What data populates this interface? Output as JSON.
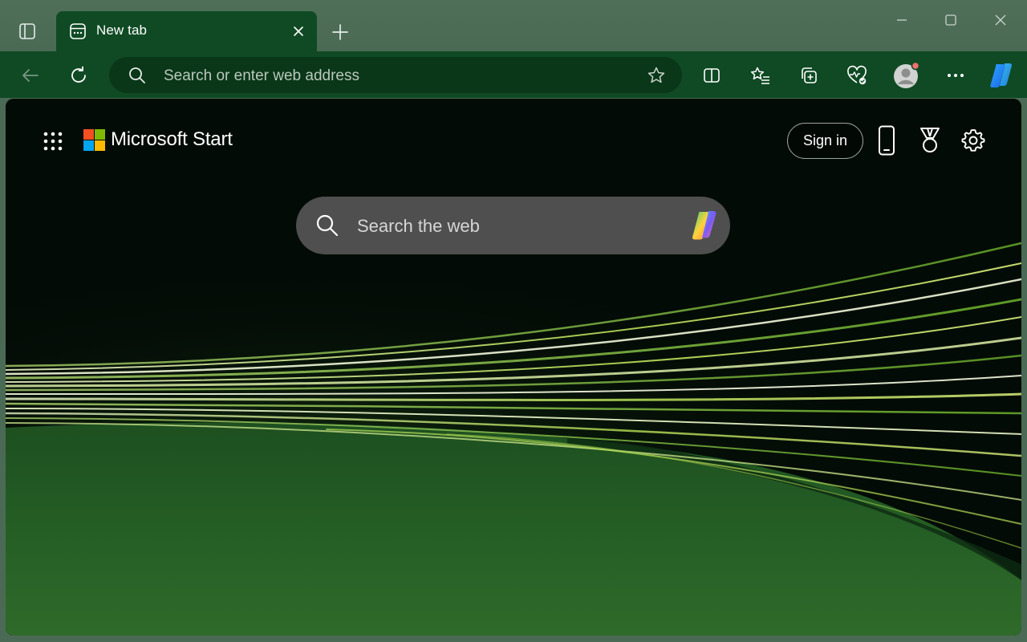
{
  "browser": {
    "tab": {
      "title": "New tab"
    },
    "address_bar": {
      "placeholder": "Search or enter web address",
      "value": ""
    },
    "colors": {
      "frame": "#4b6a55",
      "toolbar": "#0f4a24",
      "omnibox": "#0a3718"
    }
  },
  "page": {
    "brand": "Microsoft Start",
    "sign_in_label": "Sign in",
    "search": {
      "placeholder": "Search the web",
      "value": ""
    },
    "logo_colors": [
      "#f25022",
      "#7fba00",
      "#00a4ef",
      "#ffb900"
    ]
  }
}
